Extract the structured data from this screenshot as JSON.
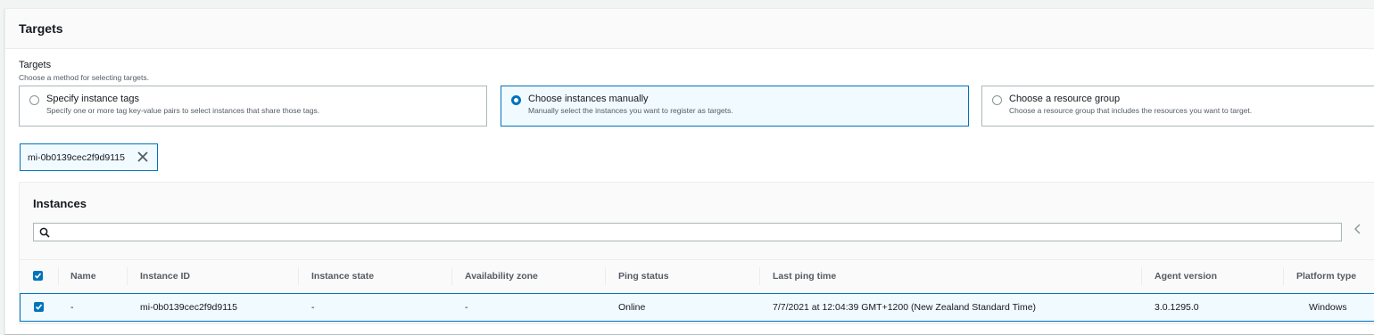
{
  "panel": {
    "title": "Targets"
  },
  "targets": {
    "label": "Targets",
    "description": "Choose a method for selecting targets.",
    "options": [
      {
        "title": "Specify instance tags",
        "description": "Specify one or more tag key-value pairs to select instances that share those tags.",
        "selected": false
      },
      {
        "title": "Choose instances manually",
        "description": "Manually select the instances you want to register as targets.",
        "selected": true
      },
      {
        "title": "Choose a resource group",
        "description": "Choose a resource group that includes the resources you want to target.",
        "selected": false
      }
    ]
  },
  "token": {
    "label": "mi-0b0139cec2f9d9115",
    "remove_icon": "close-icon"
  },
  "instances": {
    "title": "Instances",
    "search": {
      "placeholder": "",
      "value": ""
    },
    "columns": [
      "Name",
      "Instance ID",
      "Instance state",
      "Availability zone",
      "Ping status",
      "Last ping time",
      "Agent version",
      "Platform type"
    ],
    "header_checked": true,
    "rows": [
      {
        "checked": true,
        "cells": [
          "-",
          "mi-0b0139cec2f9d9115",
          "-",
          "-",
          "Online",
          "7/7/2021 at 12:04:39 GMT+1200 (New Zealand Standard Time)",
          "3.0.1295.0",
          "Windows"
        ]
      }
    ]
  },
  "colors": {
    "accent": "#0073bb",
    "selected_bg": "#f1faff",
    "border": "#aab7b8"
  }
}
